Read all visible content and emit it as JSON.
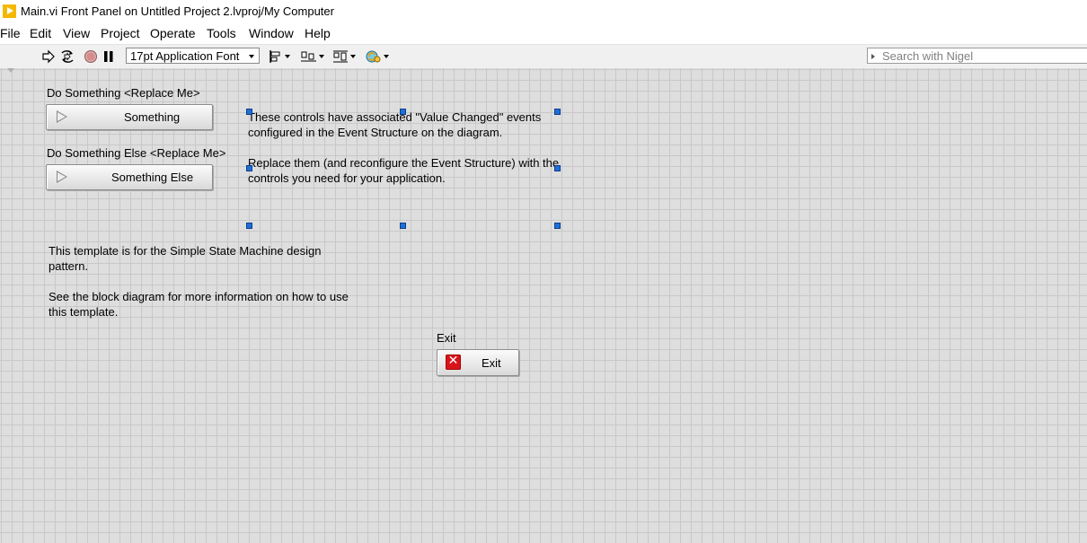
{
  "window": {
    "title": "Main.vi Front Panel on Untitled Project 2.lvproj/My Computer"
  },
  "menu": {
    "items": [
      "File",
      "Edit",
      "View",
      "Project",
      "Operate",
      "Tools",
      "Window",
      "Help"
    ]
  },
  "toolbar": {
    "font_select_value": "17pt Application Font",
    "search_placeholder": "Search with Nigel"
  },
  "panel": {
    "controls": {
      "do_something": {
        "label": "Do Something <Replace Me>",
        "button_text": "Something"
      },
      "do_something_else": {
        "label": "Do Something Else <Replace Me>",
        "button_text": "Something Else"
      },
      "exit": {
        "label": "Exit",
        "button_text": "Exit"
      }
    },
    "notes": {
      "event_line1": "These controls have associated \"Value Changed\" events",
      "event_line2": "configured in the Event Structure on the diagram.",
      "replace_line1": "Replace them (and reconfigure the Event Structure) with the",
      "replace_line2": "controls you need for your application.",
      "template_line1": "This template is for the Simple State Machine design",
      "template_line2": "pattern.",
      "diagram_line1": "See the block diagram for more information on how to use",
      "diagram_line2": "this template."
    }
  },
  "colors": {
    "title_icon": "#f5b800",
    "selection_handle": "#1f6fd6",
    "exit_icon": "#d8141b",
    "panel_grid": "#dedede"
  }
}
